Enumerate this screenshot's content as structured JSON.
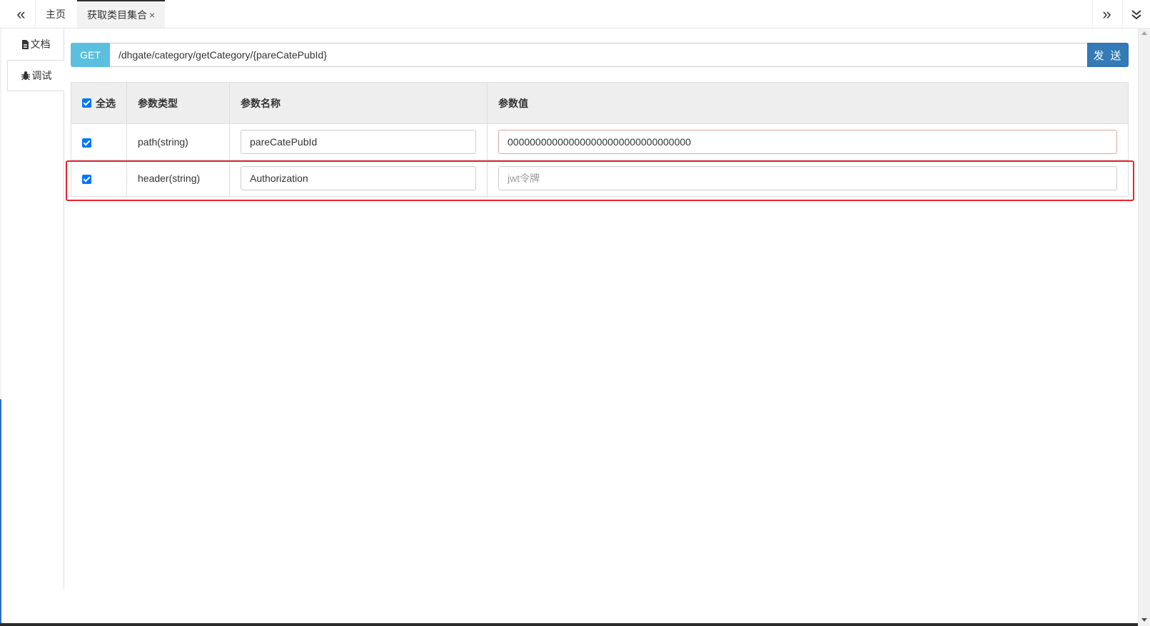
{
  "tabs": {
    "home": "主页",
    "active": "获取类目集合",
    "close_glyph": "×"
  },
  "nav": {
    "prev_glyph": "«",
    "next_glyph": "»"
  },
  "side_tabs": {
    "doc": "文档",
    "debug": "调试"
  },
  "request": {
    "method": "GET",
    "url": "/dhgate/category/getCategory/{pareCatePubId}",
    "send_label": "发 送"
  },
  "param_table": {
    "headers": {
      "select_all": "全选",
      "type": "参数类型",
      "name": "参数名称",
      "value": "参数值"
    },
    "rows": [
      {
        "checked": true,
        "type": "path(string)",
        "name": "pareCatePubId",
        "value": "000000000000000000000000000000000",
        "value_placeholder": ""
      },
      {
        "checked": true,
        "type": "header(string)",
        "name": "Authorization",
        "value": "",
        "value_placeholder": "jwt令牌"
      }
    ]
  },
  "colors": {
    "method_badge": "#5bc0de",
    "send_button": "#337ab7",
    "highlight_border": "#e8232f",
    "checkbox": "#0075ff"
  }
}
